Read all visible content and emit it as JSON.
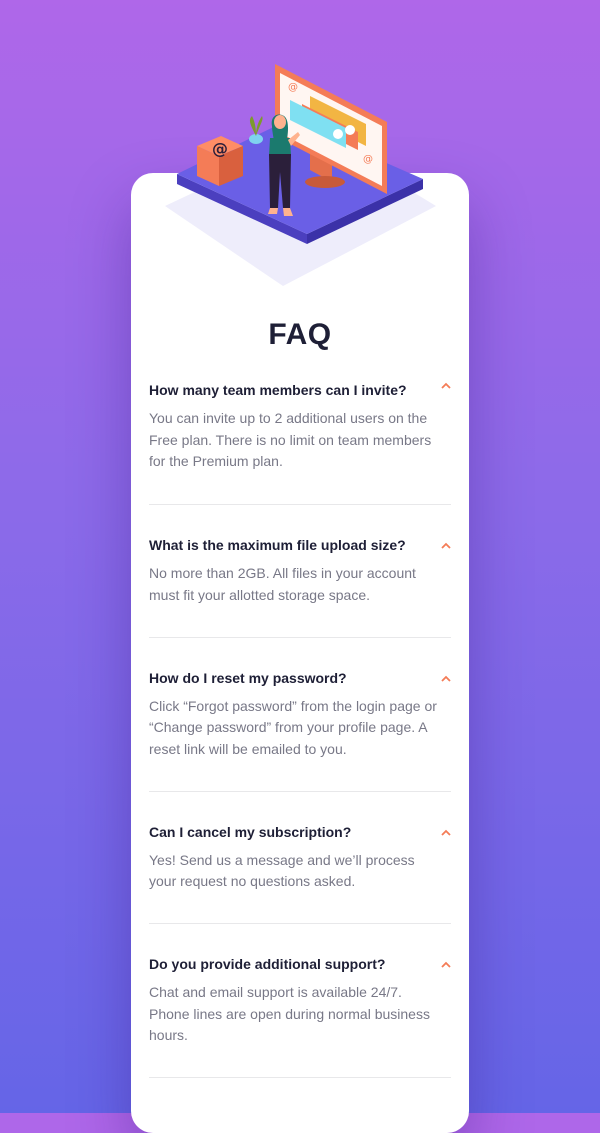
{
  "page": {
    "title": "FAQ"
  },
  "colors": {
    "bg_top": "#af67e9",
    "bg_bottom": "#6565e7",
    "card": "#ffffff",
    "heading": "#1e1f36",
    "body_text": "#787887",
    "accent": "#f47c57",
    "divider": "#e8e8ea"
  },
  "icons": {
    "toggle": "chevron-up-icon",
    "hero": "woman-at-online-desk-illustration"
  },
  "faq": {
    "items": [
      {
        "question": "How many team members can I invite?",
        "answer": "You can invite up to 2 additional users on the Free plan. There is no limit on team members for the Premium plan.",
        "expanded": true
      },
      {
        "question": "What is the maximum file upload size?",
        "answer": "No more than 2GB. All files in your account must fit your allotted storage space.",
        "expanded": true
      },
      {
        "question": "How do I reset my password?",
        "answer": "Click “Forgot password” from the login page or “Change password” from your profile page. A reset link will be emailed to you.",
        "expanded": true
      },
      {
        "question": "Can I cancel my subscription?",
        "answer": "Yes! Send us a message and we’ll process your request no questions asked.",
        "expanded": true
      },
      {
        "question": "Do you provide additional support?",
        "answer": "Chat and email support is available 24/7. Phone lines are open during normal business hours.",
        "expanded": true
      }
    ]
  }
}
